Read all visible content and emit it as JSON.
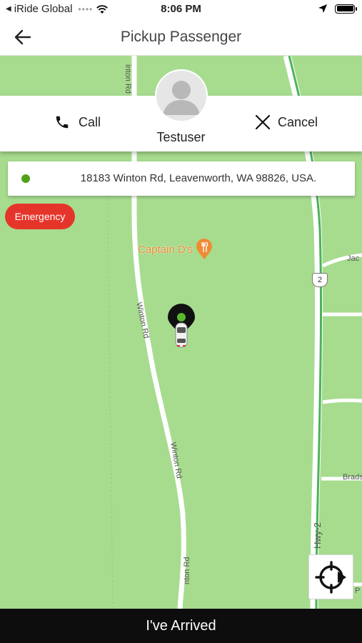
{
  "status_bar": {
    "back_app": "iRide Global",
    "time": "8:06 PM"
  },
  "header": {
    "title": "Pickup Passenger"
  },
  "passenger": {
    "name": "Testuser",
    "call_label": "Call",
    "cancel_label": "Cancel"
  },
  "pickup": {
    "address": "18183 Winton Rd, Leavenworth, WA 98826, USA."
  },
  "emergency_label": "Emergency",
  "map": {
    "labels": {
      "poi": "Captain D's",
      "road_winton_top": "inton Rd",
      "road_winton_mid": "Winton Rd",
      "road_winton_low": "Winton Rd",
      "road_winton_bottom": "nton Rd",
      "road_jac": "Jac",
      "road_brads": "Brads",
      "road_p": "P",
      "highway": "Hwy-2",
      "shield_number": "2"
    },
    "colors": {
      "land": "#a7dc8f",
      "road": "#ffffff",
      "highway": "#4cb35a",
      "poi": "#f08a33"
    }
  },
  "arrived_label": "I've Arrived",
  "icons": {
    "back": "arrow-left-icon",
    "call": "phone-icon",
    "cancel": "close-icon",
    "locate": "my-location-icon",
    "car": "car-marker-icon"
  }
}
